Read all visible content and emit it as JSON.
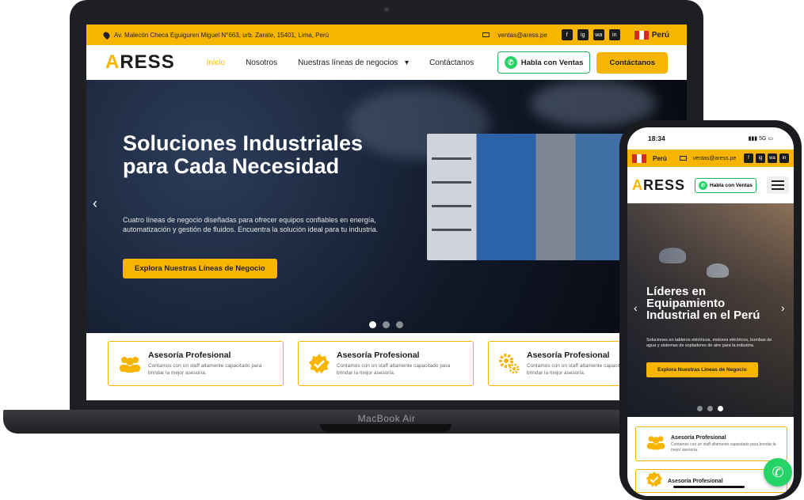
{
  "laptop": {
    "brand_label": "MacBook Air",
    "topbar": {
      "address": "Av. Malecón Checa Eguiguren Miguel N°663, urb. Zarate, 15401, Lima, Perú",
      "email": "ventas@aress.pe",
      "social": [
        "f",
        "ig",
        "wa",
        "in"
      ],
      "country": "Perú"
    },
    "nav": {
      "logo_accent": "A",
      "logo_rest": "RESS",
      "items": [
        "Inicio",
        "Nosotros",
        "Nuestras líneas de negocios",
        "Contáctanos"
      ],
      "dropdown_caret": "▾",
      "whatsapp_label": "Habla con Ventas",
      "contact_button": "Contáctanos"
    },
    "hero": {
      "title": "Soluciones Industriales para Cada Necesidad",
      "text": "Cuatro líneas de negocio diseñadas para ofrecer equipos confiables en energía, automatización y gestión de fluidos. Encuentra la solución ideal para tu industria.",
      "cta": "Explora Nuestras Líneas de Negocio",
      "prev_arrow": "‹",
      "slides_total": 3,
      "slide_active": 1
    },
    "features": [
      {
        "title": "Asesoría Profesional",
        "text": "Contamos con un staff altamente capacitado para brindar la mejor asesoría.",
        "icon": "users-icon"
      },
      {
        "title": "Asesoría Profesional",
        "text": "Contamos con un staff altamente capacitado para brindar la mejor asesoría.",
        "icon": "badge-check-icon"
      },
      {
        "title": "Asesoría Profesional",
        "text": "Contamos con un staff altamente capacitado para brindar la mejor asesoría.",
        "icon": "gears-icon"
      }
    ]
  },
  "phone": {
    "status": {
      "time": "18:34",
      "network": "5G"
    },
    "topbar": {
      "country": "Perú",
      "email": "ventas@aress.pe"
    },
    "nav": {
      "logo_accent": "A",
      "logo_rest": "RESS",
      "whatsapp_label": "Habla con Ventas"
    },
    "hero": {
      "title": "Líderes en Equipamiento Industrial en el Perú",
      "text": "Soluciones en tableros eléctricos, motores eléctricos, bombas de agua y sistemas de sopladores de aire para la industria.",
      "cta": "Explora Nuestras Líneas de Negocio",
      "prev_arrow": "‹",
      "next_arrow": "›",
      "slides_total": 3,
      "slide_active": 3
    },
    "features": [
      {
        "title": "Asesoría Profesional",
        "text": "Contamos con un staff altamente capacitado para brindar la mejor asesoría."
      },
      {
        "title": "Asesoría Profesional"
      }
    ]
  },
  "colors": {
    "accent": "#f7b500",
    "whatsapp": "#25d366",
    "dark": "#1b1b1b"
  }
}
